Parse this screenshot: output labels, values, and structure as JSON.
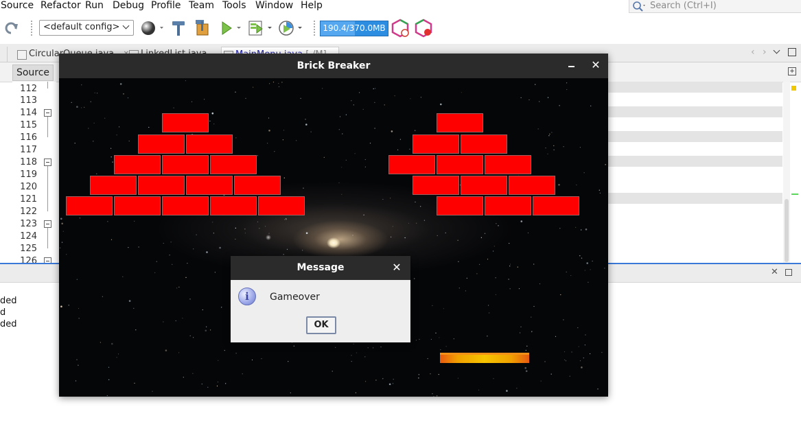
{
  "menubar": {
    "items": [
      "Source",
      "Refactor",
      "Run",
      "Debug",
      "Profile",
      "Team",
      "Tools",
      "Window",
      "Help"
    ],
    "search_placeholder": "Search (Ctrl+I)"
  },
  "toolbar": {
    "config_value": "<default config>",
    "memory_text": "190.4/370.0MB",
    "memory_fraction": 0.51,
    "icons": [
      "redo-icon",
      "globe-icon",
      "build-hammer-icon",
      "clean-build-icon",
      "run-icon",
      "debug-icon",
      "profile-icon",
      "apply-code-changes-icon",
      "profile-ide-icon"
    ]
  },
  "editor": {
    "tabs": [
      {
        "label": "CircularQueue.java",
        "active": false
      },
      {
        "label": "LinkedList.java",
        "active": false
      },
      {
        "label": "MainMenu.java",
        "suffix": "[-/M]",
        "active": true
      }
    ],
    "source_button": "Source",
    "line_numbers": [
      "112",
      "113",
      "114",
      "115",
      "116",
      "117",
      "118",
      "119",
      "120",
      "121",
      "122",
      "123",
      "124",
      "125",
      "126"
    ]
  },
  "output": {
    "lines": [
      "ded",
      "d",
      "ded"
    ]
  },
  "game_window": {
    "title": "Brick Breaker",
    "brick_color": "#ff0000",
    "paddle_color": "#f6c400"
  },
  "dialog": {
    "title": "Message",
    "message": "Gameover",
    "ok_label": "OK",
    "icon": "information-icon"
  }
}
